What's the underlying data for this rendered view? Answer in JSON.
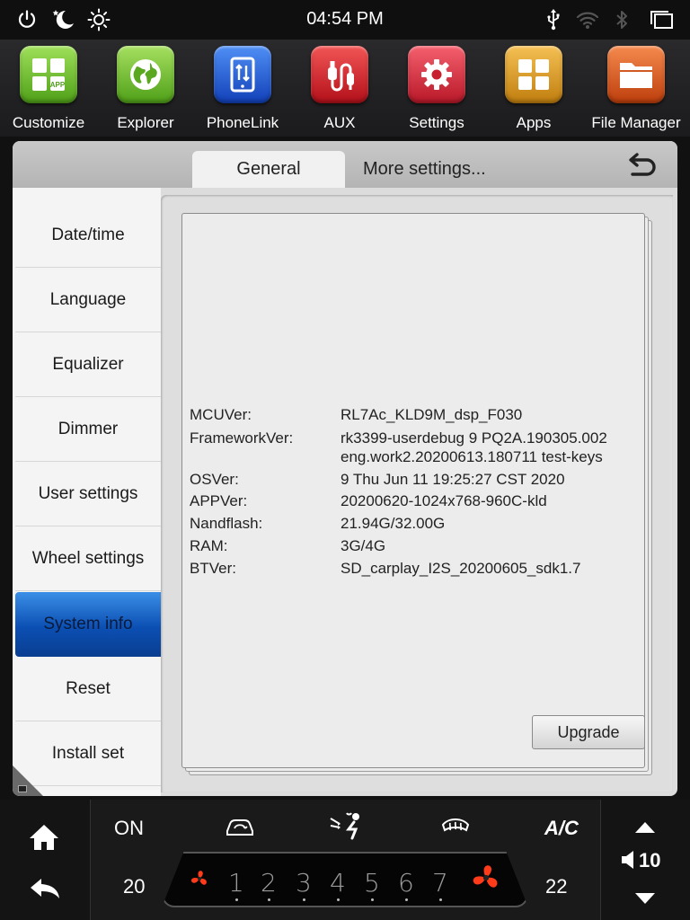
{
  "status_bar": {
    "time": "04:54 PM",
    "left_icons": [
      "power-icon",
      "night-mode-icon",
      "brightness-icon"
    ],
    "right_icons": [
      "usb-icon",
      "wifi-icon",
      "bluetooth-icon",
      "recent-apps-icon"
    ]
  },
  "dock": {
    "apps": [
      {
        "label": "Customize",
        "icon": "customize-icon",
        "color": "#6fbf2e",
        "badge": "APP"
      },
      {
        "label": "Explorer",
        "icon": "globe-icon",
        "color": "#6fbf2e"
      },
      {
        "label": "PhoneLink",
        "icon": "phonelink-icon",
        "color": "#1e5fd6"
      },
      {
        "label": "AUX",
        "icon": "aux-cable-icon",
        "color": "#d6202a"
      },
      {
        "label": "Settings",
        "icon": "gear-icon",
        "color": "#d82a3e"
      },
      {
        "label": "Apps",
        "icon": "apps-grid-icon",
        "color": "#d99a20"
      },
      {
        "label": "File Manager",
        "icon": "folder-icon",
        "color": "#d9531a"
      }
    ]
  },
  "tabs": {
    "general": "General",
    "more": "More settings..."
  },
  "sidebar": {
    "items": [
      {
        "label": "Date/time"
      },
      {
        "label": "Language"
      },
      {
        "label": "Equalizer"
      },
      {
        "label": "Dimmer"
      },
      {
        "label": "User settings"
      },
      {
        "label": "Wheel settings"
      },
      {
        "label": "System info",
        "active": true
      },
      {
        "label": "Reset"
      },
      {
        "label": "Install set"
      }
    ]
  },
  "system_info": {
    "rows": [
      {
        "key": "MCUVer:",
        "value": "RL7Ac_KLD9M_dsp_F030"
      },
      {
        "key": "FrameworkVer:",
        "value": "rk3399-userdebug 9 PQ2A.190305.002",
        "value2": "eng.work2.20200613.180711 test-keys"
      },
      {
        "key": "OSVer:",
        "value": "9  Thu Jun 11 19:25:27 CST 2020"
      },
      {
        "key": "APPVer:",
        "value": "20200620-1024x768-960C-kld"
      },
      {
        "key": "Nandflash:",
        "value": "21.94G/32.00G"
      },
      {
        "key": "RAM:",
        "value": "3G/4G"
      },
      {
        "key": "BTVer:",
        "value": "SD_carplay_I2S_20200605_sdk1.7"
      }
    ],
    "upgrade_label": "Upgrade"
  },
  "climate": {
    "power": "ON",
    "ac": "A/C",
    "left_temp": "20",
    "right_temp": "22",
    "volume": "10",
    "fan_levels": [
      "1",
      "2",
      "3",
      "4",
      "5",
      "6",
      "7"
    ],
    "accent_color": "#ff3b1a"
  }
}
